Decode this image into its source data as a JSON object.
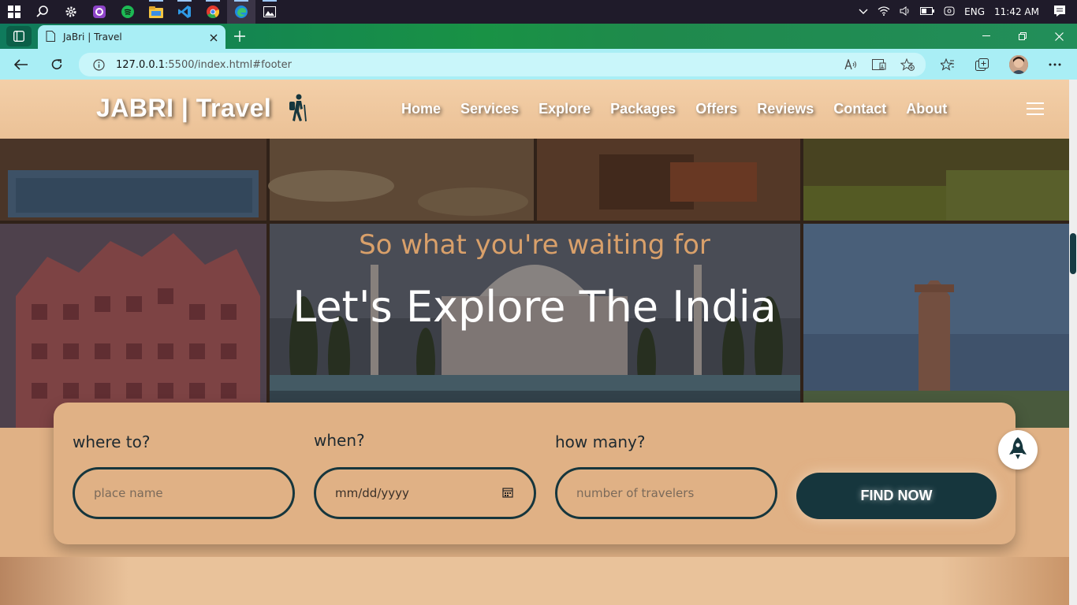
{
  "taskbar": {
    "icons": [
      "windows-start-icon",
      "search-icon",
      "settings-icon",
      "github-icon",
      "spotify-icon",
      "file-explorer-icon",
      "vscode-icon",
      "chrome-icon",
      "edge-icon",
      "photos-icon"
    ],
    "language": "ENG",
    "time": "11:42 AM"
  },
  "browser": {
    "tab_title": "JaBri | Travel",
    "url_host": "127.0.0.1",
    "url_path": ":5500/index.html#footer"
  },
  "header": {
    "logo": "JABRI | Travel",
    "nav": [
      "Home",
      "Services",
      "Explore",
      "Packages",
      "Offers",
      "Reviews",
      "Contact",
      "About"
    ]
  },
  "hero": {
    "subtitle": "So what you're waiting for",
    "title": "Let's Explore The India"
  },
  "search": {
    "where_label": "where to?",
    "where_placeholder": "place name",
    "when_label": "when?",
    "when_placeholder": "mm/dd/yyyy",
    "howmany_label": "how many?",
    "howmany_placeholder": "number of travelers",
    "button": "FIND NOW"
  },
  "colors": {
    "page_bg": "#e0b185",
    "dark_teal": "#16363d",
    "hero_sub": "#d9a06a",
    "tab_bg": "#a9eef5"
  }
}
